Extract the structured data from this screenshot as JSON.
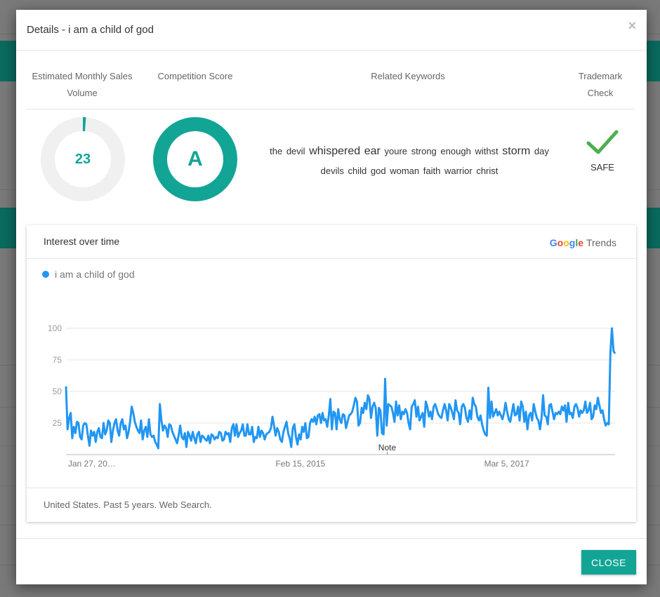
{
  "modal": {
    "title": "Details - i am a child of god",
    "close_x": "×",
    "close_label": "CLOSE"
  },
  "headers": {
    "sales": "Estimated Monthly Sales Volume",
    "competition": "Competition Score",
    "keywords": "Related Keywords",
    "trademark": "Trademark Check"
  },
  "sales_volume": {
    "value": "23",
    "fill_fraction": 0.012
  },
  "competition": {
    "score": "A"
  },
  "keywords": [
    {
      "text": "the",
      "size": "normal"
    },
    {
      "text": "devil",
      "size": "normal"
    },
    {
      "text": "whispered",
      "size": "big"
    },
    {
      "text": "ear",
      "size": "big"
    },
    {
      "text": "youre",
      "size": "normal"
    },
    {
      "text": "strong",
      "size": "normal"
    },
    {
      "text": "enough",
      "size": "normal"
    },
    {
      "text": "withst",
      "size": "normal"
    },
    {
      "text": "storm",
      "size": "big"
    },
    {
      "text": "day",
      "size": "normal"
    },
    {
      "text": "devils",
      "size": "normal"
    },
    {
      "text": "child",
      "size": "normal"
    },
    {
      "text": "god",
      "size": "normal"
    },
    {
      "text": "woman",
      "size": "normal"
    },
    {
      "text": "faith",
      "size": "normal"
    },
    {
      "text": "warrior",
      "size": "normal"
    },
    {
      "text": "christ",
      "size": "normal"
    }
  ],
  "trademark": {
    "status": "SAFE",
    "icon": "checkmark-icon"
  },
  "trends": {
    "title": "Interest over time",
    "logo_google": "Google",
    "logo_trends": "Trends",
    "footer": "United States. Past 5 years. Web Search."
  },
  "colors": {
    "accent": "#12a596",
    "line": "#2196f3",
    "check": "#4caf50"
  },
  "chart_data": {
    "type": "line",
    "series": [
      {
        "name": "i am a child of god",
        "values": [
          54,
          20,
          29,
          33,
          13,
          22,
          17,
          26,
          25,
          14,
          12,
          23,
          25,
          24,
          15,
          7,
          19,
          15,
          18,
          10,
          18,
          21,
          14,
          13,
          25,
          16,
          19,
          27,
          25,
          10,
          19,
          25,
          28,
          19,
          15,
          25,
          28,
          20,
          23,
          13,
          18,
          26,
          38,
          33,
          26,
          22,
          19,
          17,
          27,
          12,
          19,
          22,
          14,
          28,
          16,
          14,
          15,
          10,
          8,
          5,
          40,
          27,
          19,
          23,
          21,
          14,
          24,
          23,
          18,
          15,
          12,
          9,
          15,
          23,
          14,
          12,
          17,
          6,
          18,
          15,
          11,
          18,
          13,
          9,
          16,
          18,
          10,
          15,
          14,
          12,
          11,
          15,
          9,
          16,
          15,
          12,
          14,
          13,
          18,
          17,
          11,
          12,
          18,
          16,
          17,
          10,
          21,
          24,
          15,
          24,
          14,
          17,
          19,
          24,
          15,
          15,
          24,
          16,
          16,
          22,
          10,
          14,
          13,
          22,
          14,
          19,
          17,
          12,
          16,
          17,
          18,
          21,
          30,
          23,
          15,
          21,
          18,
          12,
          10,
          18,
          22,
          26,
          17,
          13,
          6,
          21,
          24,
          14,
          8,
          16,
          12,
          22,
          18,
          25,
          13,
          14,
          25,
          28,
          26,
          30,
          24,
          31,
          32,
          25,
          33,
          27,
          28,
          22,
          31,
          44,
          20,
          34,
          33,
          20,
          36,
          28,
          25,
          32,
          31,
          21,
          26,
          31,
          32,
          34,
          39,
          45,
          42,
          23,
          25,
          37,
          33,
          41,
          36,
          47,
          44,
          29,
          38,
          41,
          37,
          15,
          37,
          35,
          17,
          16,
          60,
          23,
          40,
          39,
          38,
          33,
          26,
          42,
          31,
          39,
          28,
          34,
          32,
          36,
          33,
          25,
          20,
          38,
          40,
          43,
          30,
          38,
          27,
          30,
          33,
          22,
          42,
          38,
          30,
          34,
          28,
          38,
          40,
          36,
          32,
          30,
          29,
          35,
          40,
          35,
          27,
          40,
          37,
          33,
          28,
          43,
          35,
          33,
          24,
          38,
          40,
          37,
          29,
          26,
          35,
          28,
          45,
          40,
          38,
          30,
          27,
          31,
          24,
          19,
          16,
          15,
          53,
          29,
          42,
          30,
          33,
          36,
          31,
          34,
          31,
          28,
          33,
          41,
          34,
          28,
          26,
          33,
          40,
          31,
          32,
          38,
          27,
          42,
          38,
          26,
          34,
          20,
          31,
          33,
          27,
          40,
          34,
          29,
          27,
          20,
          29,
          47,
          31,
          30,
          24,
          39,
          40,
          34,
          28,
          33,
          32,
          34,
          32,
          38,
          35,
          39,
          26,
          41,
          32,
          33,
          29,
          38,
          40,
          37,
          30,
          35,
          33,
          35,
          42,
          33,
          35,
          41,
          28,
          30,
          39,
          36,
          45,
          39,
          33,
          35,
          28,
          23,
          25,
          24,
          80,
          100,
          82,
          80
        ]
      }
    ],
    "x_tick_labels": [
      "Jan 27, 20…",
      "Feb 15, 2015",
      "Mar 5, 2017"
    ],
    "y_ticks": [
      25,
      50,
      75,
      100
    ],
    "ylim": [
      0,
      100
    ],
    "annotation": "Note",
    "grid": true
  }
}
